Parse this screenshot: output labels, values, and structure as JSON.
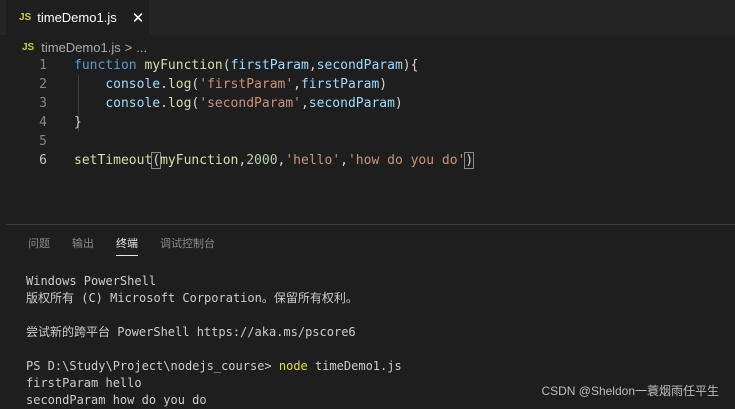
{
  "tab": {
    "icon": "JS",
    "filename": "timeDemo1.js",
    "close": "✕"
  },
  "breadcrumb": {
    "icon": "JS",
    "filename": "timeDemo1.js",
    "separator": ">",
    "more": "..."
  },
  "editor": {
    "active_line": 6,
    "lines": [
      {
        "num": "1"
      },
      {
        "num": "2"
      },
      {
        "num": "3"
      },
      {
        "num": "4"
      },
      {
        "num": "5"
      },
      {
        "num": "6"
      }
    ],
    "tokens": {
      "l1_kw": "function",
      "l1_fn": "myFunction",
      "l1_open": "(",
      "l1_p1": "firstParam",
      "l1_comma": ",",
      "l1_p2": "secondParam",
      "l1_close": "){",
      "l2_obj": "console",
      "l2_dot": ".",
      "l2_fn": "log",
      "l2_open": "(",
      "l2_str": "'firstParam'",
      "l2_comma": ",",
      "l2_arg": "firstParam",
      "l2_close": ")",
      "l3_obj": "console",
      "l3_dot": ".",
      "l3_fn": "log",
      "l3_open": "(",
      "l3_str": "'secondParam'",
      "l3_comma": ",",
      "l3_arg": "secondParam",
      "l3_close": ")",
      "l4_close": "}",
      "l6_fn": "setTimeout",
      "l6_open": "(",
      "l6_arg": "myFunction",
      "l6_c1": ",",
      "l6_num": "2000",
      "l6_c2": ",",
      "l6_s1": "'hello'",
      "l6_c3": ",",
      "l6_s2": "'how do you do'",
      "l6_close": ")"
    }
  },
  "panel": {
    "tabs": [
      {
        "label": "问题"
      },
      {
        "label": "输出"
      },
      {
        "label": "终端"
      },
      {
        "label": "调试控制台"
      }
    ],
    "active_tab": "终端"
  },
  "terminal": {
    "l1": "Windows PowerShell",
    "l2": "版权所有 (C) Microsoft Corporation。保留所有权利。",
    "l3": "尝试新的跨平台 PowerShell https://aka.ms/pscore6",
    "prompt": "PS D:\\Study\\Project\\nodejs_course> ",
    "cmd": "node",
    "cmd_arg": " timeDemo1.js",
    "out1": "firstParam hello",
    "out2": "secondParam how do you do"
  },
  "watermark": "CSDN @Sheldon一蓑烟雨任平生",
  "colors": {
    "keyword": "#569cd6",
    "function": "#dcdcaa",
    "param": "#9cdcfe",
    "string": "#ce9178",
    "number": "#b5cea8",
    "js_icon": "#cbcb41",
    "command": "#e5e510"
  }
}
